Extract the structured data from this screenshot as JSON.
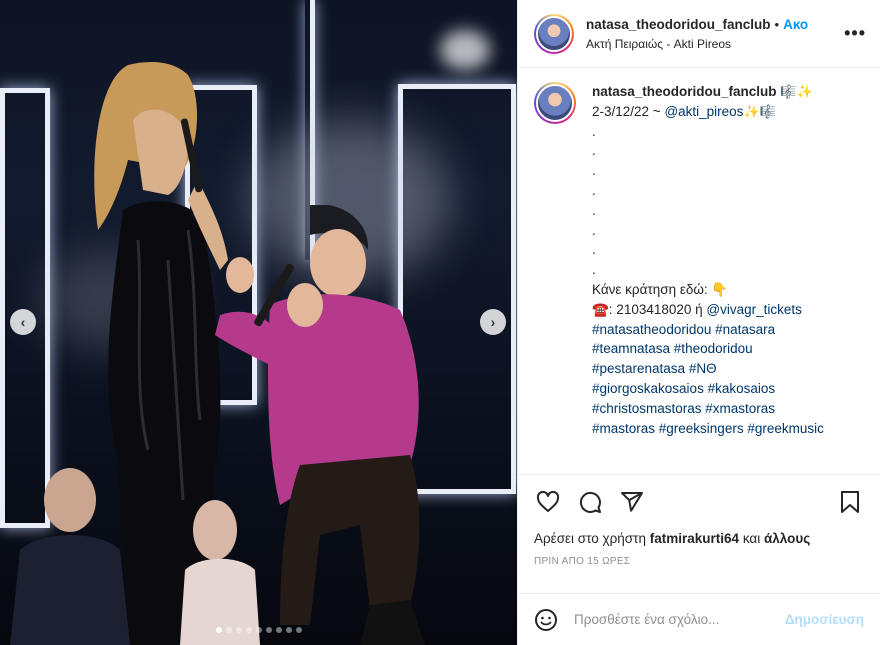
{
  "post": {
    "username": "natasa_theodoridou_fanclub",
    "separator": "•",
    "follow_label": "Ακο",
    "location": "Ακτή Πειραιώς - Akti Pireos",
    "more_label": "•••"
  },
  "caption": {
    "username": "natasa_theodoridou_fanclub",
    "title_emojis": "🎼✨",
    "line1_text": "2-3/12/22 ~ ",
    "line1_mention": "@akti_pireos",
    "line1_emojis": " ✨🎼",
    "dots": [
      ".",
      ".",
      ".",
      ".",
      ".",
      ".",
      ".",
      "."
    ],
    "booking_text": "Κάνε κράτηση εδώ: 👇",
    "phone_text": "☎️: 2103418020 ή ",
    "phone_mention": "@vivagr_tickets",
    "hashtag_lines": [
      "#natasatheodoridou #natasara",
      "#teamnatasa #theodoridou",
      "#pestarenatasa #ΝΘ",
      "#giorgoskakosaios #kakosaios",
      "#christosmastoras #xmastoras",
      "#mastoras #greeksingers #greekmusic"
    ]
  },
  "likes": {
    "prefix": "Αρέσει στο χρήστη",
    "user": "fatmirakurti64",
    "middle": "και",
    "others": "άλλους"
  },
  "timestamp": "ΠΡΙΝ ΑΠΟ 15 ΩΡΕΣ",
  "comment": {
    "placeholder": "Προσθέστε ένα σχόλιο...",
    "post_label": "Δημοσίευση"
  },
  "carousel": {
    "prev": "‹",
    "next": "›",
    "slide_count": 9,
    "active_index": 0
  },
  "colors": {
    "accent": "#0095f6",
    "post_disabled": "#b2dffc",
    "mention": "#00376b"
  }
}
